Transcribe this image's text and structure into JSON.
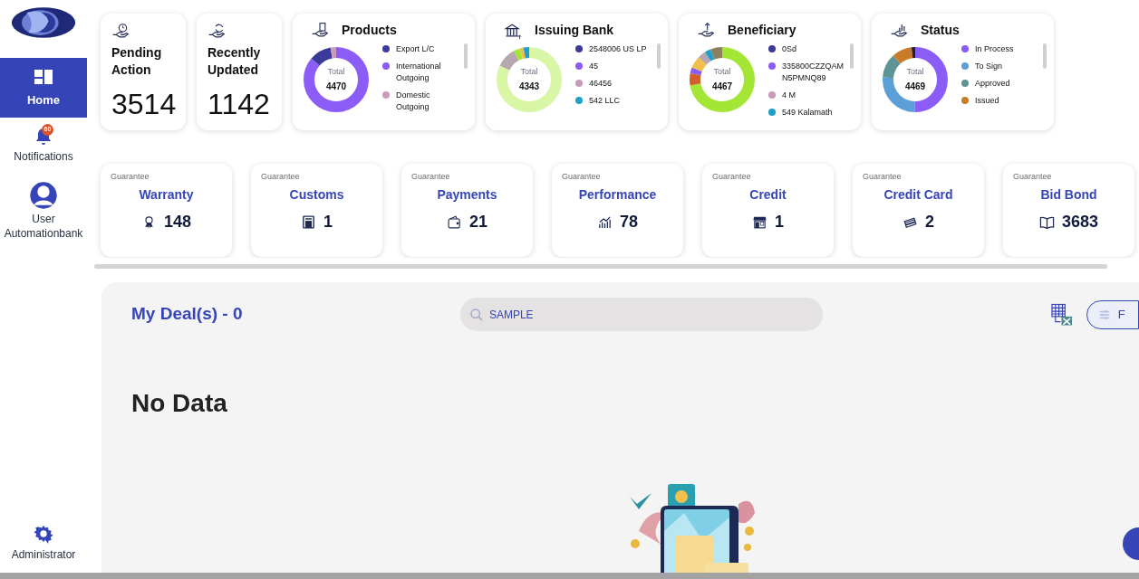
{
  "sidebar": {
    "items": [
      {
        "kind": "home",
        "label": "Home",
        "selected": true
      },
      {
        "kind": "bell",
        "label": "Notifications",
        "badge": "60",
        "selected": false
      },
      {
        "kind": "user",
        "label": "User Automationbank",
        "selected": false
      }
    ],
    "footer": {
      "label": "Administrator"
    }
  },
  "summary": [
    {
      "title": "Pending Action",
      "value": "3514"
    },
    {
      "title": "Recently Updated",
      "value": "1142"
    }
  ],
  "donut_cards": [
    {
      "title": "Products",
      "total_label": "Total",
      "total": "4470",
      "legend": [
        {
          "label": "Export L/C",
          "color": "#3b3a9a"
        },
        {
          "label": "International Outgoing",
          "color": "#8b5cf6"
        },
        {
          "label": "Domestic Outgoing",
          "color": "#c89bb8"
        }
      ]
    },
    {
      "title": "Issuing Bank",
      "total_label": "Total",
      "total": "4343",
      "legend": [
        {
          "label": "2548006 US LP",
          "color": "#3b3a9a"
        },
        {
          "label": "45",
          "color": "#8b5cf6"
        },
        {
          "label": "46456",
          "color": "#c89bb8"
        },
        {
          "label": "542 LLC",
          "color": "#1fa0c8"
        }
      ]
    },
    {
      "title": "Beneficiary",
      "total_label": "Total",
      "total": "4467",
      "legend": [
        {
          "label": "0Sd",
          "color": "#3b3a9a"
        },
        {
          "label": "335800CZZQAM N5PMNQ89",
          "color": "#8b5cf6"
        },
        {
          "label": "4 M",
          "color": "#c89bb8"
        },
        {
          "label": "549 Kalamath",
          "color": "#1fa0c8"
        }
      ]
    },
    {
      "title": "Status",
      "total_label": "Total",
      "total": "4469",
      "legend": [
        {
          "label": "In Process",
          "color": "#8b5cf6"
        },
        {
          "label": "To Sign",
          "color": "#5b9fd6"
        },
        {
          "label": "Approved",
          "color": "#5f9494"
        },
        {
          "label": "Issued",
          "color": "#c87c2a"
        }
      ]
    }
  ],
  "guarantees": [
    {
      "kind": "award",
      "caption": "Guarantee",
      "title": "Warranty",
      "count": "148"
    },
    {
      "kind": "building",
      "caption": "Guarantee",
      "title": "Customs",
      "count": "1"
    },
    {
      "kind": "wallet",
      "caption": "Guarantee",
      "title": "Payments",
      "count": "21"
    },
    {
      "kind": "chart",
      "caption": "Guarantee",
      "title": "Performance",
      "count": "78"
    },
    {
      "kind": "shop",
      "caption": "Guarantee",
      "title": "Credit",
      "count": "1"
    },
    {
      "kind": "cards",
      "caption": "Guarantee",
      "title": "Credit Card",
      "count": "2"
    },
    {
      "kind": "book",
      "caption": "Guarantee",
      "title": "Bid Bond",
      "count": "3683"
    }
  ],
  "deals": {
    "title": "My Deal(s) - 0",
    "search": {
      "value": "SAMPLE"
    },
    "filter_button": "F",
    "empty_message": "No Data"
  }
}
